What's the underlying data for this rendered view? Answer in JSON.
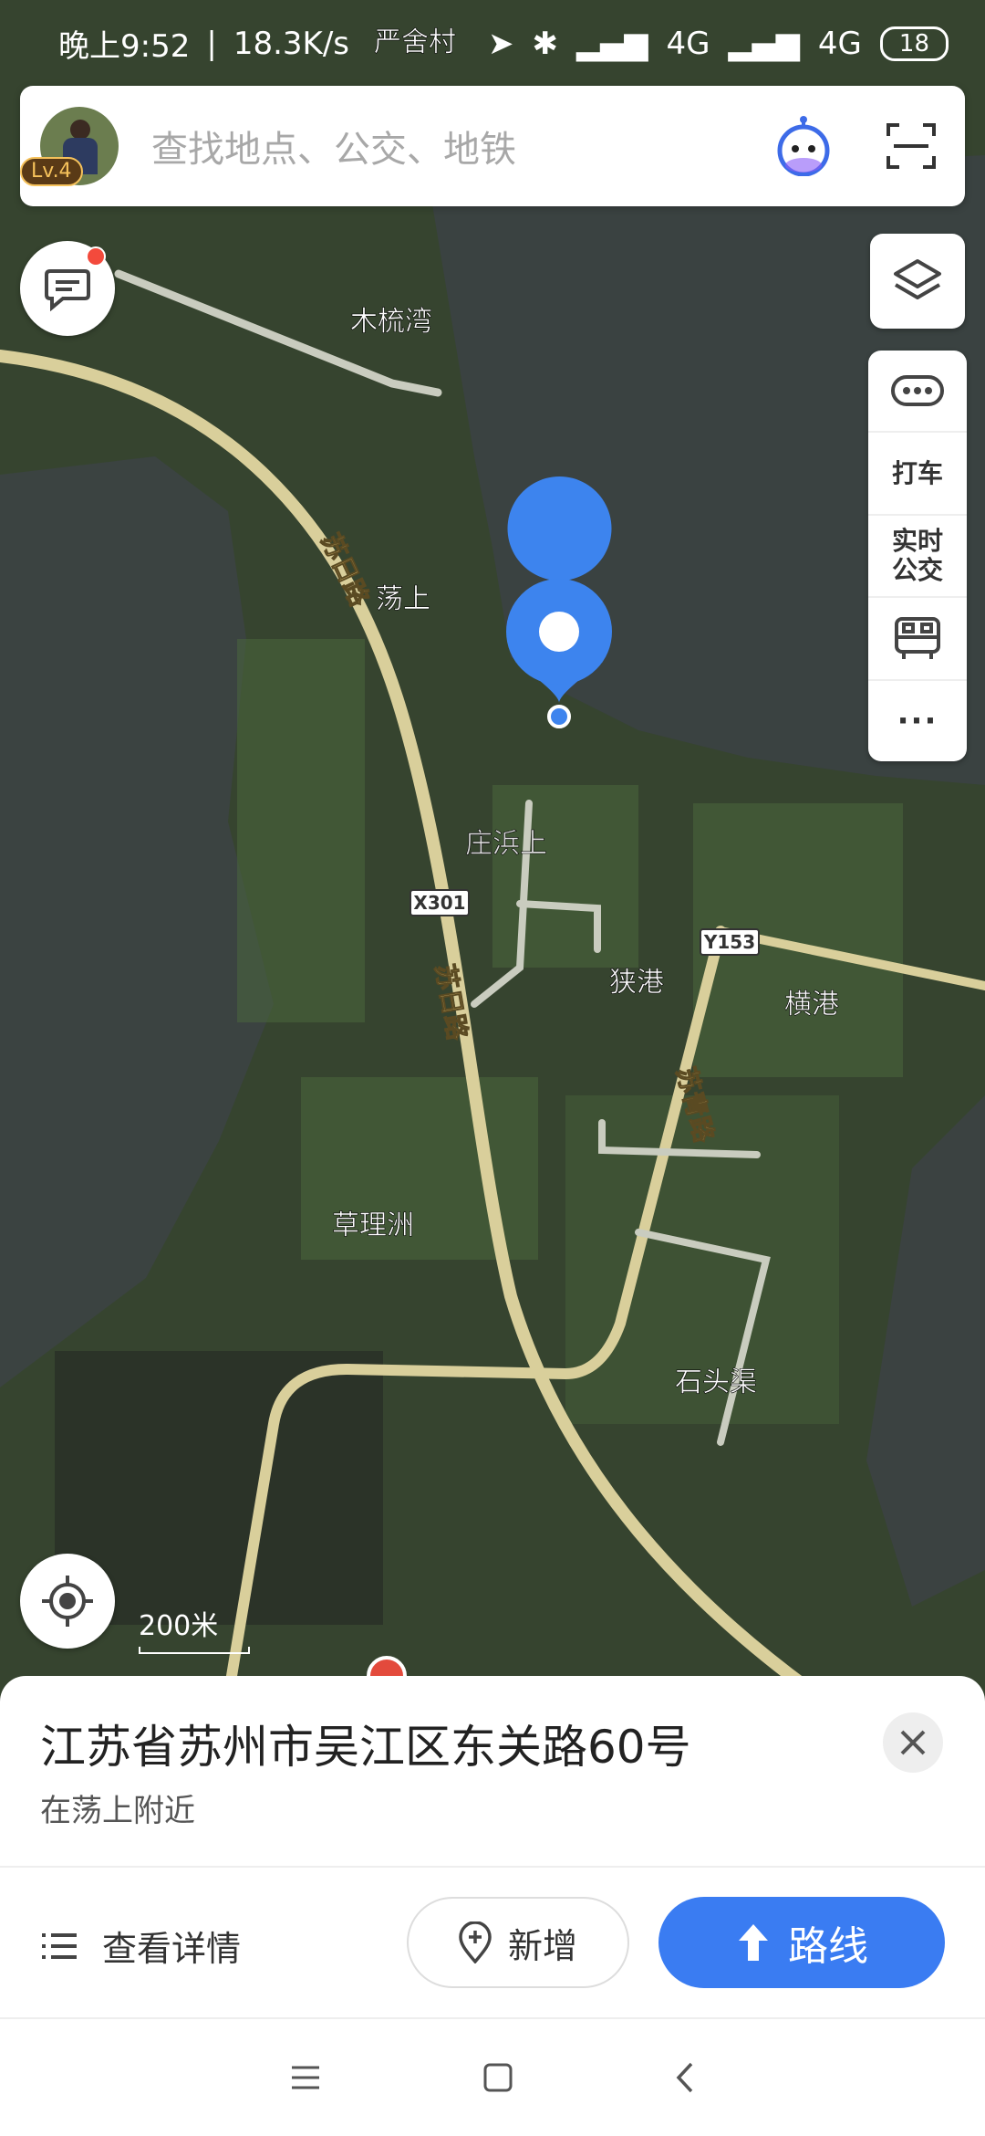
{
  "status_bar": {
    "time": "晚上9:52",
    "speed": "18.3K/s",
    "network1": "4G",
    "network2": "4G",
    "battery": "18"
  },
  "search": {
    "placeholder": "查找地点、公交、地铁",
    "level_badge": "Lv.4"
  },
  "map": {
    "places": [
      "严舍村",
      "木梳湾",
      "荡上",
      "庄浜上",
      "狭港",
      "横港",
      "草理洲",
      "石头渠"
    ],
    "roads": [
      "苏日路",
      "苏日路",
      "苏青路"
    ],
    "road_shields": [
      "X301",
      "Y153"
    ],
    "scale_label": "200米"
  },
  "side_tools": [
    "打车",
    "实时公交"
  ],
  "sheet": {
    "address": "江苏省苏州市吴江区东关路60号",
    "nearby": "在荡上附近",
    "detail_label": "查看详情",
    "add_label": "新增",
    "route_label": "路线"
  },
  "colors": {
    "accent": "#3a7cf2",
    "pin": "#3d84ee",
    "water": "#39423f",
    "land": "#3e5a33"
  }
}
